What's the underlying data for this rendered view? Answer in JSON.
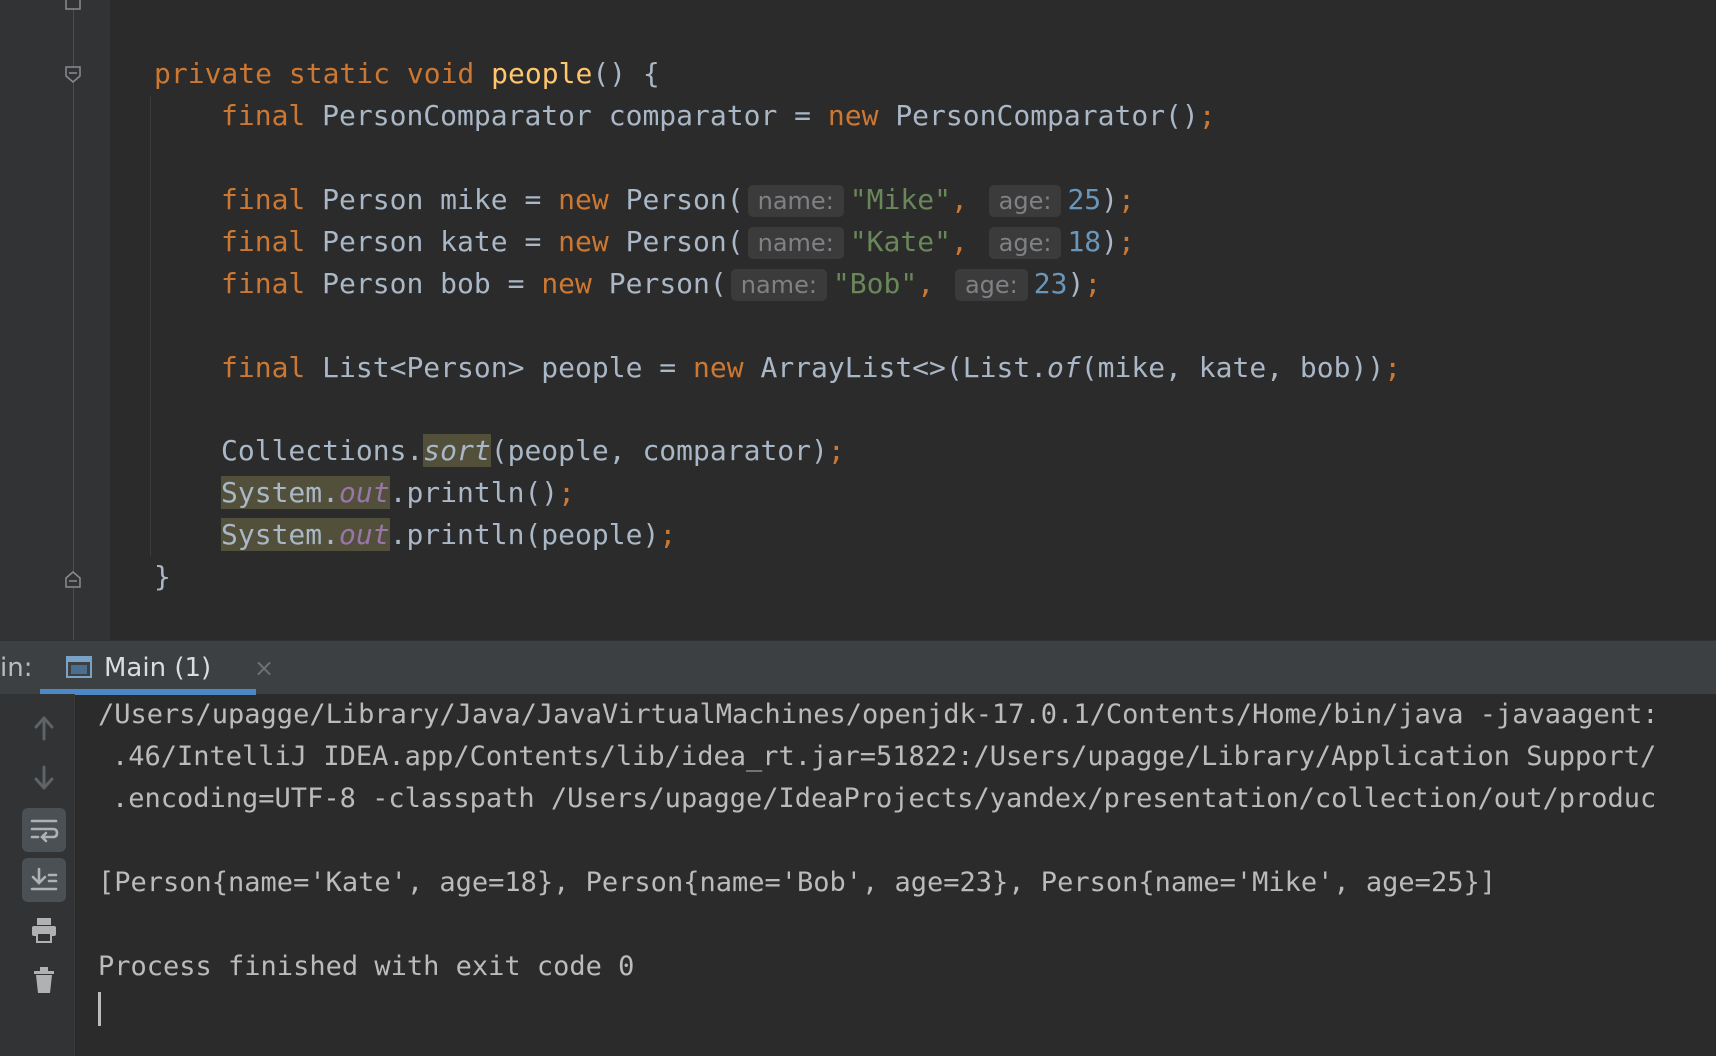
{
  "editor": {
    "method_modifiers": "private static void",
    "method_name": "people",
    "method_open": "() {",
    "comparator_line": {
      "kw": "final",
      "decl": "PersonComparator comparator = ",
      "new_kw": "new",
      "ctor": "PersonComparator()",
      "semi": ";"
    },
    "persons": [
      {
        "decl": "Person mike = ",
        "ctor": "Person(",
        "name_hint": "name:",
        "name_value": "\"Mike\"",
        "age_hint": "age:",
        "age_value": "25"
      },
      {
        "decl": "Person kate = ",
        "ctor": "Person(",
        "name_hint": "name:",
        "name_value": "\"Kate\"",
        "age_hint": "age:",
        "age_value": "18"
      },
      {
        "decl": "Person bob = ",
        "ctor": "Person(",
        "name_hint": "name:",
        "name_value": "\"Bob\"",
        "age_hint": "age:",
        "age_value": "23"
      }
    ],
    "list_line": {
      "decl": "List<Person> people = ",
      "ctor": "ArrayList<>(List.",
      "of": "of",
      "args": "(mike, kate, bob))"
    },
    "sort_line": {
      "owner": "Collections.",
      "method": "sort",
      "args": "(people, comparator)"
    },
    "println_lines": [
      {
        "owner": "System.",
        "field": "out",
        "call": ".println()"
      },
      {
        "owner": "System.",
        "field": "out",
        "call": ".println(people)"
      }
    ],
    "closing_brace": "}",
    "keywords": {
      "final": "final",
      "new": "new",
      "semi": ";",
      "comma": ","
    }
  },
  "run_panel": {
    "label": "in:",
    "tab_label": "Main (1)",
    "tab_close": "×",
    "console_lines": [
      "/Users/upagge/Library/Java/JavaVirtualMachines/openjdk-17.0.1/Contents/Home/bin/java -javaagent:",
      ".46/IntelliJ IDEA.app/Contents/lib/idea_rt.jar=51822:/Users/upagge/Library/Application Support/",
      ".encoding=UTF-8 -classpath /Users/upagge/IdeaProjects/yandex/presentation/collection/out/produc",
      "[Person{name='Kate', age=18}, Person{name='Bob', age=23}, Person{name='Mike', age=25}]",
      "Process finished with exit code 0"
    ],
    "toolbar": [
      "up-arrow-icon",
      "down-arrow-icon",
      "soft-wrap-icon",
      "scroll-to-end-icon",
      "print-icon",
      "trash-icon"
    ]
  },
  "colors": {
    "background": "#2b2b2b",
    "keyword": "#cc7832",
    "function": "#ffc66d",
    "string": "#6a8759",
    "number": "#6897bb",
    "field": "#9876aa",
    "tab_accent": "#4a88c7"
  }
}
